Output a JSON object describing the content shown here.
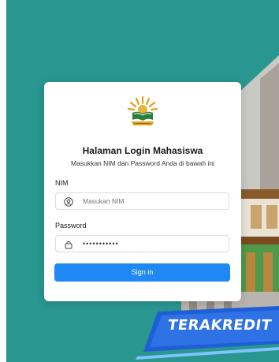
{
  "login": {
    "title": "Halaman Login Mahasiswa",
    "subtitle": "Masukkan NIM dan Password Anda di bawah ini",
    "nim_label": "NIM",
    "nim_placeholder": "Masukan NIM",
    "password_label": "Password",
    "password_value": "•••••••••••",
    "signin_label": "Sign in"
  },
  "background": {
    "banner_text": "TERAKREDIT"
  },
  "colors": {
    "background_teal": "#2a9690",
    "button_blue": "#1e88f5",
    "banner_blue": "#1f5fd6"
  },
  "icons": {
    "username": "person-circle-icon",
    "password": "lock-icon"
  }
}
